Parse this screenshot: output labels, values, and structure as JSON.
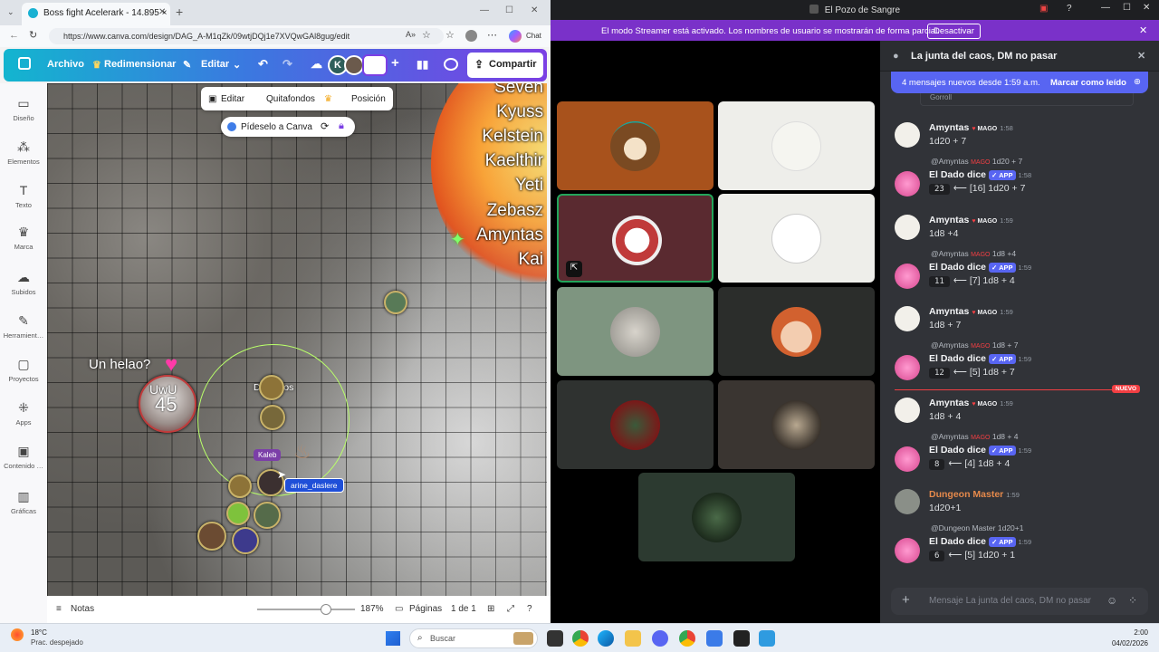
{
  "browser": {
    "tab_title": "Boss fight Acelerark - 14.895 × 1",
    "url": "https://www.canva.com/design/DAG_A-M1qZk/09wtjDQj1e7XVQwGAl8gug/edit",
    "chat_label": "Chat"
  },
  "canva": {
    "menu_file": "Archivo",
    "menu_resize": "Redimensionar",
    "menu_edit": "Editar",
    "share": "Compartir",
    "avatar_letter": "K",
    "rail": [
      "Diseño",
      "Elementos",
      "Texto",
      "Marca",
      "Subidos",
      "Herramient…",
      "Proyectos",
      "Apps",
      "Contenido …",
      "Gráficas"
    ],
    "ctx": {
      "edit": "Editar",
      "remove_bg": "Quitafondos",
      "position": "Posición"
    },
    "ask_canva": "Pídeselo a Canva",
    "initiative": [
      "Seven",
      "Kyuss",
      "Kelstein",
      "Kaelthir",
      "Yeti",
      "Zebasz",
      "Amyntas",
      "Kai"
    ],
    "map_labels": {
      "helao": "Un helao?",
      "doblados": "Doblados",
      "kaleb": "Kaleb",
      "marine": "arine_daslere",
      "uwu": "UwU",
      "hp": "45"
    },
    "bottom": {
      "notes": "Notas",
      "zoom": "187%",
      "pages": "Páginas",
      "page_count": "1 de 1"
    }
  },
  "discord": {
    "window_title": "El Pozo de Sangre",
    "streamer_notice": "El modo Streamer está activado. Los nombres de usuario se mostrarán de forma parcial.",
    "streamer_button": "Desactivar",
    "channel_title": "La junta del caos, DM no pasar",
    "new_messages": "4 mensajes nuevos desde 1:59 a.m.",
    "mark_read": "Marcar como leído",
    "partial_name": "Gorroll",
    "new_divider": "NUEVO",
    "input_placeholder": "Mensaje La junta del caos, DM no pasar",
    "messages": [
      {
        "type": "user",
        "name": "Amyntas",
        "tag": "MAGO",
        "time": "1:58",
        "text": "1d20 + 7"
      },
      {
        "type": "bot",
        "reply_to": "@Amyntas",
        "reply_tag": "MAGO",
        "reply_text": "1d20 + 7",
        "name": "El Dado dice",
        "app": "✓ APP",
        "time": "1:58",
        "total": "23",
        "detail": "⟵ [16] 1d20 + 7"
      },
      {
        "type": "user",
        "name": "Amyntas",
        "tag": "MAGO",
        "time": "1:59",
        "text": "1d8 +4"
      },
      {
        "type": "bot",
        "reply_to": "@Amyntas",
        "reply_tag": "MAGO",
        "reply_text": "1d8 +4",
        "name": "El Dado dice",
        "app": "✓ APP",
        "time": "1:59",
        "total": "11",
        "detail": "⟵ [7] 1d8 + 4"
      },
      {
        "type": "user",
        "name": "Amyntas",
        "tag": "MAGO",
        "time": "1:59",
        "text": "1d8 + 7"
      },
      {
        "type": "bot",
        "reply_to": "@Amyntas",
        "reply_tag": "MAGO",
        "reply_text": "1d8 + 7",
        "name": "El Dado dice",
        "app": "✓ APP",
        "time": "1:59",
        "total": "12",
        "detail": "⟵ [5] 1d8 + 7"
      },
      {
        "type": "user",
        "name": "Amyntas",
        "tag": "MAGO",
        "time": "1:59",
        "text": "1d8 + 4"
      },
      {
        "type": "bot",
        "reply_to": "@Amyntas",
        "reply_tag": "MAGO",
        "reply_text": "1d8 + 4",
        "name": "El Dado dice",
        "app": "✓ APP",
        "time": "1:59",
        "total": "8",
        "detail": "⟵ [4] 1d8 + 4"
      },
      {
        "type": "user",
        "name": "Dungeon Master",
        "tag": "",
        "time": "1:59",
        "text": "1d20+1"
      },
      {
        "type": "bot",
        "reply_to": "@Dungeon Master",
        "reply_tag": "",
        "reply_text": "1d20+1",
        "name": "El Dado dice",
        "app": "✓ APP",
        "time": "1:59",
        "total": "6",
        "detail": "⟵ [5] 1d20 + 1"
      }
    ]
  },
  "taskbar": {
    "weather_temp": "18°C",
    "weather_desc": "Prac. despejado",
    "search": "Buscar",
    "time": "2:00",
    "date": "04/02/2026"
  },
  "colors": {
    "canva_gradient_start": "#13b5cf",
    "canva_gradient_end": "#7b3fe4",
    "streamer_bar": "#7a31c9",
    "discord_blurple": "#5865f2",
    "new_divider": "#f23f43"
  }
}
